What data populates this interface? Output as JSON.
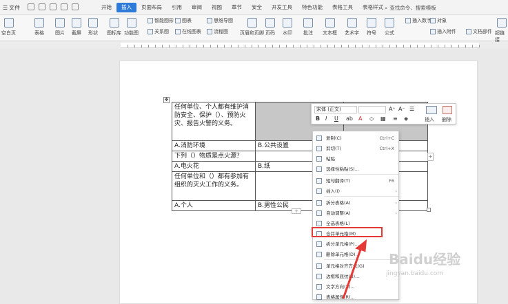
{
  "topbar": {
    "file_label": "文件",
    "tabs": [
      "开始",
      "插入",
      "页面布局",
      "引用",
      "审阅",
      "视图",
      "章节",
      "安全",
      "开发工具",
      "特色功能",
      "表格工具",
      "表格样式"
    ],
    "active_tab": "插入",
    "search_label": "查找命令、搜索模板"
  },
  "ribbon": {
    "items": [
      "空白页",
      "表格",
      "图片",
      "截屏",
      "形状",
      "图标库",
      "功能图",
      "智能图形",
      "关系图",
      "图表",
      "在线图表",
      "思维导图",
      "流程图",
      "页眉和页脚",
      "页码",
      "水印",
      "批注",
      "文本框",
      "艺术字",
      "符号",
      "公式",
      "插入数字",
      "对象",
      "插入附件",
      "文档部件",
      "超链接"
    ]
  },
  "table": {
    "rows": [
      [
        "任何单位、个人都有维护消防安全、保护（）、预防火灾、报告火警的义务。",
        "",
        ""
      ],
      [
        "A.消防环境",
        "B.公共设置",
        ""
      ],
      [
        "下列（）物质是点火源？",
        "",
        ""
      ],
      [
        "A.电火花",
        "B.纸",
        ""
      ],
      [
        "任何单位和（）都有参加有组织的灭火工作的义务。",
        "",
        ""
      ],
      [
        "A.个人",
        "B.男性公民",
        ""
      ]
    ]
  },
  "mini_toolbar": {
    "font": "宋体 (正文)",
    "insert_label": "插入",
    "delete_label": "删除"
  },
  "context_menu": {
    "items": [
      {
        "label": "复制(C)",
        "shortcut": "Ctrl+C"
      },
      {
        "label": "剪切(T)",
        "shortcut": "Ctrl+X"
      },
      {
        "label": "粘贴",
        "shortcut": ""
      },
      {
        "label": "选择性粘贴(S)...",
        "shortcut": ""
      },
      {
        "label": "短句翻译(T)",
        "shortcut": "F6"
      },
      {
        "label": "插入(I)",
        "shortcut": ""
      },
      {
        "label": "拆分表格(A)",
        "shortcut": ""
      },
      {
        "label": "自动调整(A)",
        "shortcut": ""
      },
      {
        "label": "全选表格(L)",
        "shortcut": ""
      },
      {
        "label": "合并单元格(M)",
        "shortcut": ""
      },
      {
        "label": "拆分单元格(P)...",
        "shortcut": ""
      },
      {
        "label": "删除单元格(D)...",
        "shortcut": ""
      },
      {
        "label": "单元格对齐方式(G)",
        "shortcut": ""
      },
      {
        "label": "边框和底纹(B)...",
        "shortcut": ""
      },
      {
        "label": "文字方向(X)...",
        "shortcut": ""
      },
      {
        "label": "表格属性(R)...",
        "shortcut": ""
      }
    ],
    "highlight_index": 9
  },
  "watermark": {
    "brand": "Baidu经验",
    "url": "jingyan.baidu.com"
  },
  "colors": {
    "accent": "#2f7bd9",
    "highlight": "#e53935",
    "selected_cell": "#c7c7c7"
  }
}
